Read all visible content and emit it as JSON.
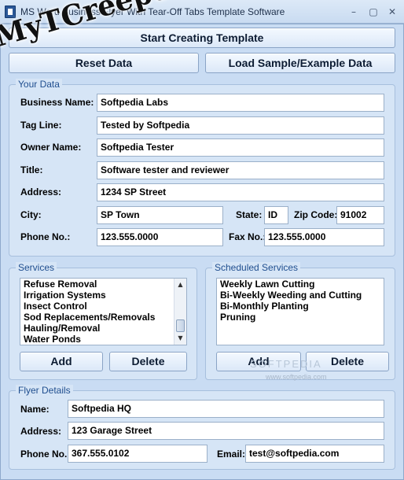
{
  "window": {
    "title": "MS Word Business Flyer With Tear-Off Tabs Template Software",
    "minimize": "–",
    "restore": "▢",
    "close": "✕"
  },
  "toolbar": {
    "start_label": "Start Creating Template",
    "reset_label": "Reset Data",
    "load_sample_label": "Load Sample/Example Data"
  },
  "your_data": {
    "group_label": "Your Data",
    "business_name_label": "Business Name:",
    "business_name_value": "Softpedia Labs",
    "tag_line_label": "Tag Line:",
    "tag_line_value": "Tested by Softpedia",
    "owner_name_label": "Owner Name:",
    "owner_name_value": "Softpedia Tester",
    "title_label": "Title:",
    "title_value": "Software tester and reviewer",
    "address_label": "Address:",
    "address_value": "1234 SP Street",
    "city_label": "City:",
    "city_value": "SP Town",
    "state_label": "State:",
    "state_value": "ID",
    "zip_label": "Zip Code:",
    "zip_value": "91002",
    "phone_label": "Phone No.:",
    "phone_value": "123.555.0000",
    "fax_label": "Fax No.:",
    "fax_value": "123.555.0000"
  },
  "services": {
    "group_label": "Services",
    "items": [
      "Refuse Removal",
      "Irrigation Systems",
      "Insect Control",
      "Sod Replacements/Removals",
      "Hauling/Removal",
      "Water Ponds"
    ],
    "scroll_up": "▲",
    "scroll_down": "▼",
    "add_label": "Add",
    "delete_label": "Delete"
  },
  "scheduled_services": {
    "group_label": "Scheduled Services",
    "items": [
      "Weekly Lawn Cutting",
      "Bi-Weekly Weeding and Cutting",
      "Bi-Monthly Planting",
      "Pruning"
    ],
    "add_label": "Add",
    "delete_label": "Delete"
  },
  "flyer_details": {
    "group_label": "Flyer Details",
    "name_label": "Name:",
    "name_value": "Softpedia HQ",
    "address_label": "Address:",
    "address_value": "123 Garage Street",
    "phone_label": "Phone No.:",
    "phone_value": "367.555.0102",
    "email_label": "Email:",
    "email_value": "test@softpedia.com"
  },
  "watermark": {
    "text": "MyTCreeper.org",
    "softpedia": "SOFTPEDIA",
    "softpedia_url": "www.softpedia.com"
  }
}
